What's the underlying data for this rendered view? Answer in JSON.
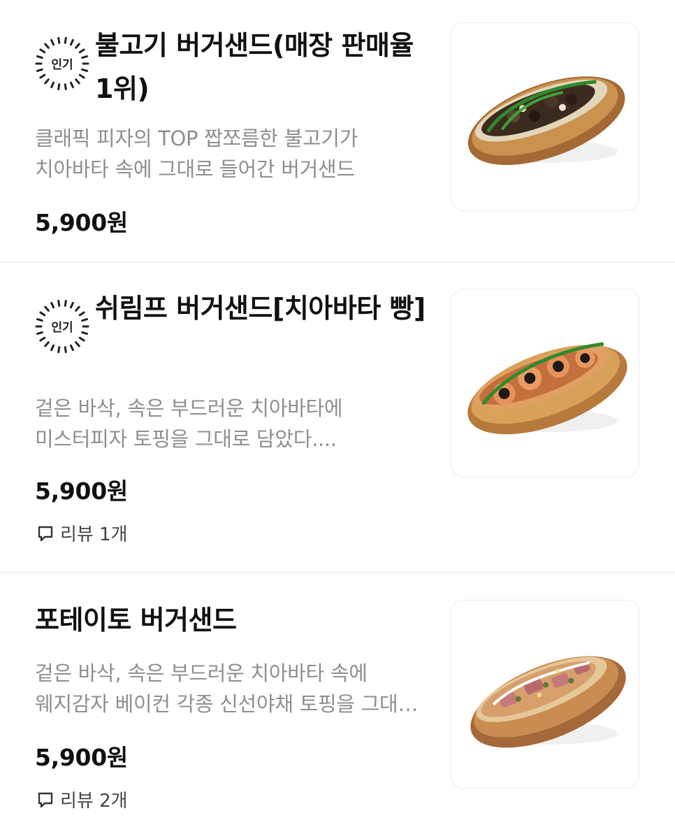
{
  "menu": {
    "items": [
      {
        "badge": "인기",
        "title": "불고기 버거샌드(매장 판매율 1위)",
        "description_lines": [
          "클래픽 피자의 TOP 짭쪼름한 불고기가",
          "치아바타 속에 그대로 들어간 버거샌드"
        ],
        "price": "5,900원",
        "image_icon": "bulgogi-sandwich-photo"
      },
      {
        "badge": "인기",
        "title": "쉬림프 버거샌드[치아바타 빵]",
        "description_lines": [
          "겉은 바삭, 속은 부드러운 치아바타에",
          "미스터피자 토핑을 그대로 담았다...."
        ],
        "price": "5,900원",
        "review": "리뷰 1개",
        "image_icon": "shrimp-sandwich-photo"
      },
      {
        "title": "포테이토 버거샌드",
        "description_lines": [
          "겉은 바삭, 속은 부드러운 치아바타 속에",
          "웨지감자 베이컨 각종 신선야채 토핑을 그대로 담았다"
        ],
        "price": "5,900원",
        "review": "리뷰 2개",
        "image_icon": "potato-sandwich-photo"
      }
    ]
  },
  "colors": {
    "text": "#111111",
    "description": "#8e8e93",
    "divider": "#f1f1f3",
    "card_border": "#ececec"
  }
}
